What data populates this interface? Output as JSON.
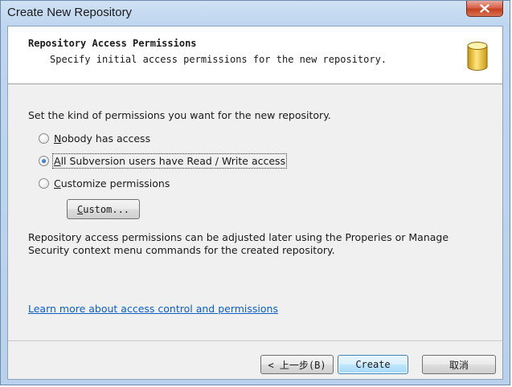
{
  "window": {
    "title": "Create New Repository"
  },
  "header": {
    "title": "Repository Access Permissions",
    "subtitle": "Specify initial access permissions for the new repository."
  },
  "body": {
    "prompt": "Set the kind of permissions you want for the new repository.",
    "options": [
      {
        "mnemonic": "N",
        "rest": "obody has access",
        "selected": false
      },
      {
        "mnemonic": "A",
        "rest": "ll Subversion users have Read / Write access",
        "selected": true
      },
      {
        "mnemonic": "C",
        "rest": "ustomize permissions",
        "selected": false
      }
    ],
    "custom_button": {
      "mnemonic": "C",
      "rest": "ustom..."
    },
    "info_text": "Repository access permissions can be adjusted later using the Properies or Manage Security context menu commands for the created repository.",
    "learn_more_link": "Learn more about access control and permissions"
  },
  "footer": {
    "back_label": "< 上一步(B)",
    "create_label": "Create",
    "cancel_label": "取消"
  },
  "colors": {
    "link": "#0b5fc7",
    "close_button": "#c5401f",
    "header_background": "#ffffff",
    "body_background": "#f0f0f0"
  },
  "icons": {
    "header": "database-icon",
    "close": "close-icon"
  }
}
